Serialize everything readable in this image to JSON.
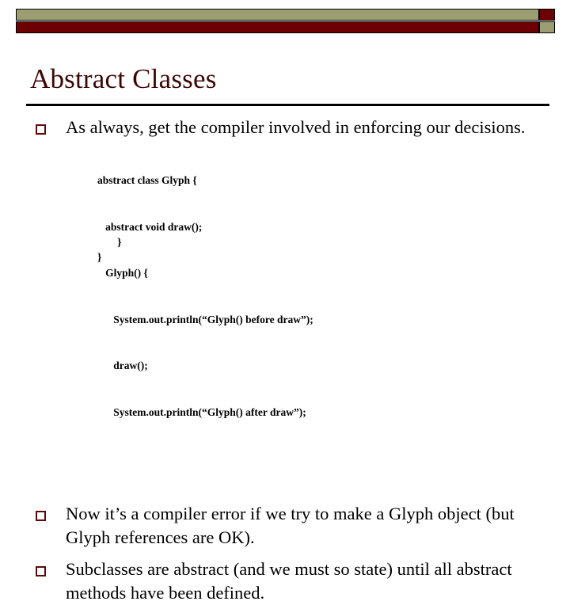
{
  "slide": {
    "title": "Abstract Classes",
    "theme": {
      "banner_olive": "#9d9d72",
      "banner_maroon": "#6d0003",
      "title_color": "#3d0705",
      "bullet_color": "#5b0b0b",
      "rule_color": "#000000",
      "body_color": "#000000",
      "background": "#ffffff"
    },
    "bullets": [
      {
        "marker": "hollow-square",
        "text": "As always, get the compiler involved in enforcing our decisions."
      },
      {
        "marker": "hollow-square",
        "text": "Now it’s a compiler error if we try to make a Glyph object (but Glyph references are OK)."
      },
      {
        "marker": "hollow-square",
        "text": "Subclasses are abstract (and we must so state) until all abstract methods have been defined."
      }
    ],
    "code_block": {
      "language": "java",
      "lines": [
        "abstract class Glyph {",
        "   abstract void draw();",
        "   Glyph() {",
        "      System.out.println(“Glyph() before draw”);",
        "      draw();",
        "      System.out.println(“Glyph() after draw”);"
      ],
      "overflow_lines": [
        "   }",
        "}"
      ]
    }
  }
}
